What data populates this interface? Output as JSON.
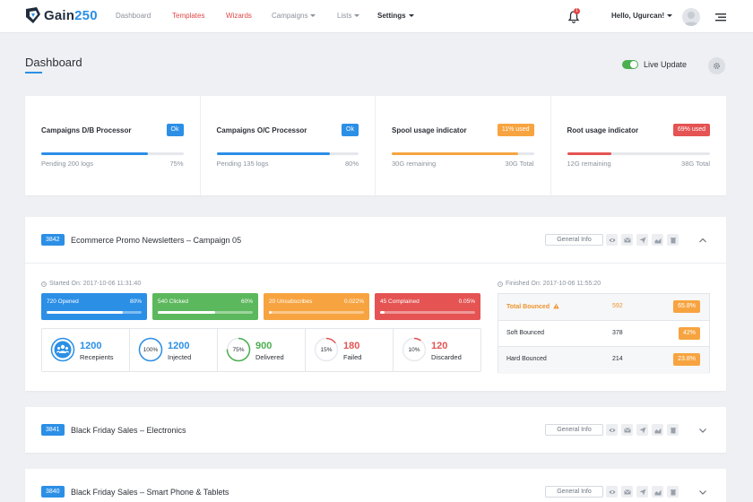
{
  "brand": {
    "name_text": "Gain",
    "name_num": "250"
  },
  "nav": {
    "links": [
      {
        "label": "Dashboard"
      },
      {
        "label": "Templates"
      },
      {
        "label": "Wizards"
      },
      {
        "label": "Campaigns"
      },
      {
        "label": "Lists"
      },
      {
        "label": "Settings"
      }
    ],
    "notifications_count": "1",
    "greeting": "Hello, Ugurcan!"
  },
  "header": {
    "title": "Dashboard",
    "live_update_label": "Live Update",
    "live_update_on": true
  },
  "indicators": [
    {
      "title": "Campaigns D/B Processor",
      "badge": "Ok",
      "badge_color": "#2b8fe6",
      "fill_color": "#2b8fe6",
      "progress": 0.75,
      "left_text": "Pending 200 logs",
      "right_text": "75%"
    },
    {
      "title": "Campaigns O/C Processor",
      "badge": "Ok",
      "badge_color": "#2b8fe6",
      "fill_color": "#2b8fe6",
      "progress": 0.8,
      "left_text": "Pending 135 logs",
      "right_text": "80%"
    },
    {
      "title": "Spool usage indicator",
      "badge": "11% used",
      "badge_color": "#f7a440",
      "fill_color": "#f7a440",
      "progress": 0.89,
      "left_text": "30G remaining",
      "right_text": "30G Total"
    },
    {
      "title": "Root usage indicator",
      "badge": "69% used",
      "badge_color": "#e55353",
      "fill_color": "#e55353",
      "progress": 0.31,
      "left_text": "12G remaining",
      "right_text": "38G Total"
    }
  ],
  "campaigns": [
    {
      "id": "3842",
      "title": "Ecommerce Promo Newsletters – Campaign 05",
      "general_info_label": "General Info",
      "expanded": true,
      "started": "Started On: 2017-10-06 11:31:40",
      "finished": "Finished On: 2017-10-06 11:55:20",
      "stats": [
        {
          "label": "720 Opened",
          "pct": "80%",
          "progress": 0.8,
          "color": "#2b8fe6"
        },
        {
          "label": "540 Clicked",
          "pct": "60%",
          "progress": 0.6,
          "color": "#5cb85c"
        },
        {
          "label": "20 Unsubscribes",
          "pct": "0.022%",
          "progress": 0.02,
          "color": "#f7a440"
        },
        {
          "label": "45 Complained",
          "pct": "0.05%",
          "progress": 0.05,
          "color": "#e55353"
        }
      ],
      "metrics": [
        {
          "value": "1200",
          "label": "Recepients",
          "ring_text": "",
          "ring_progress": 1.0,
          "color": "#2b8fe6",
          "icon": "users-icon"
        },
        {
          "value": "1200",
          "label": "Injected",
          "ring_text": "100%",
          "ring_progress": 1.0,
          "color": "#2b8fe6"
        },
        {
          "value": "900",
          "label": "Delivered",
          "ring_text": "75%",
          "ring_progress": 0.75,
          "color": "#4caf50"
        },
        {
          "value": "180",
          "label": "Failed",
          "ring_text": "15%",
          "ring_progress": 0.15,
          "color": "#e55353"
        },
        {
          "value": "120",
          "label": "Discarded",
          "ring_text": "10%",
          "ring_progress": 0.1,
          "color": "#e55353"
        }
      ],
      "bounces": [
        {
          "name": "Total Bounced",
          "count": "592",
          "pct": "65.8%",
          "warn": true
        },
        {
          "name": "Soft Bounced",
          "count": "378",
          "pct": "42%",
          "warn": false
        },
        {
          "name": "Hard Bounced",
          "count": "214",
          "pct": "23.8%",
          "warn": false
        }
      ]
    },
    {
      "id": "3841",
      "title": "Black Friday Sales – Electronics",
      "general_info_label": "General Info",
      "expanded": false
    },
    {
      "id": "3840",
      "title": "Black Friday Sales – Smart Phone & Tablets",
      "general_info_label": "General Info",
      "expanded": false
    }
  ]
}
